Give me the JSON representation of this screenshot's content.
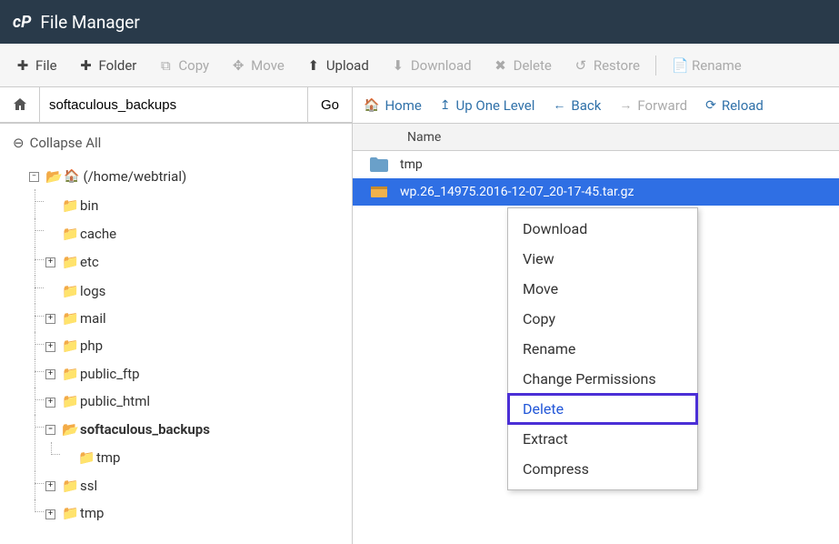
{
  "header": {
    "title": "File Manager"
  },
  "toolbar": {
    "file": "File",
    "folder": "Folder",
    "copy": "Copy",
    "move": "Move",
    "upload": "Upload",
    "download": "Download",
    "delete": "Delete",
    "restore": "Restore",
    "rename": "Rename"
  },
  "pathbar": {
    "value": "softaculous_backups",
    "go": "Go"
  },
  "collapse_all": "Collapse All",
  "tree": {
    "root_label": "(/home/webtrial)",
    "bin": "bin",
    "cache": "cache",
    "etc": "etc",
    "logs": "logs",
    "mail": "mail",
    "php": "php",
    "public_ftp": "public_ftp",
    "public_html": "public_html",
    "softaculous_backups": "softaculous_backups",
    "soft_tmp": "tmp",
    "ssl": "ssl",
    "tmp": "tmp"
  },
  "nav": {
    "home": "Home",
    "up": "Up One Level",
    "back": "Back",
    "forward": "Forward",
    "reload": "Reload"
  },
  "listhead": {
    "name": "Name"
  },
  "files": {
    "tmp": "tmp",
    "archive": "wp.26_14975.2016-12-07_20-17-45.tar.gz"
  },
  "ctx": {
    "download": "Download",
    "view": "View",
    "move": "Move",
    "copy": "Copy",
    "rename": "Rename",
    "chperm": "Change Permissions",
    "delete": "Delete",
    "extract": "Extract",
    "compress": "Compress"
  }
}
